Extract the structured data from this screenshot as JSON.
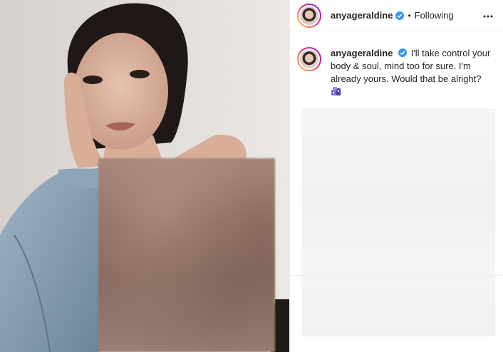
{
  "post": {
    "username": "anyageraldine",
    "separator": "•",
    "follow_status": "Following",
    "caption_username": "anyageraldine",
    "caption_text": "I'll take control your body & soul, mind too for sure. I'm already yours. Would that be alright?",
    "verified_icon": "verified-badge-icon",
    "more_icon": "more-options-icon",
    "caption_emoji_icon": "emoji-icon"
  },
  "colors": {
    "verified": "#3897f0",
    "text": "#262626",
    "border": "#efefef",
    "story_ring_start": "#f9ce34",
    "story_ring_end": "#6228d7"
  }
}
